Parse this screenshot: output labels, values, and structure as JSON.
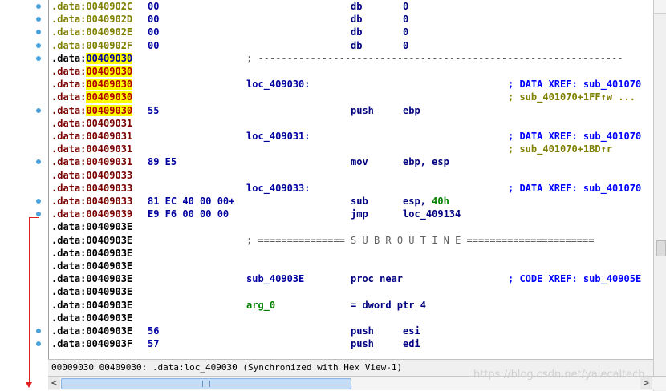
{
  "rows": [
    {
      "addr_prefix": ".data:",
      "addr": "0040902C",
      "bytes": "00",
      "mnem": "db",
      "ops": "0"
    },
    {
      "addr_prefix": ".data:",
      "addr": "0040902D",
      "bytes": "00",
      "mnem": "db",
      "ops": "0"
    },
    {
      "addr_prefix": ".data:",
      "addr": "0040902E",
      "bytes": "00",
      "mnem": "db",
      "ops": "0"
    },
    {
      "addr_prefix": ".data:",
      "addr": "0040902F",
      "bytes": "00",
      "mnem": "db",
      "ops": "0"
    },
    {
      "addr_prefix": ".data:",
      "addr": "00409030",
      "sep": "; ---------------------------------------------------------------"
    },
    {
      "addr_prefix": ".data:",
      "addr": "00409030"
    },
    {
      "addr_prefix": ".data:",
      "addr": "00409030",
      "label": "loc_409030:",
      "comment": "; DATA XREF: sub_401070"
    },
    {
      "addr_prefix": ".data:",
      "addr": "00409030",
      "comment": "; sub_401070+1FF↑w ..."
    },
    {
      "addr_prefix": ".data:",
      "addr": "00409030",
      "bytes": "55",
      "mnem": "push",
      "ops": "ebp"
    },
    {
      "addr_prefix": ".data:",
      "addr": "00409031"
    },
    {
      "addr_prefix": ".data:",
      "addr": "00409031",
      "label": "loc_409031:",
      "comment": "; DATA XREF: sub_401070"
    },
    {
      "addr_prefix": ".data:",
      "addr": "00409031",
      "comment": "; sub_401070+1BD↑r"
    },
    {
      "addr_prefix": ".data:",
      "addr": "00409031",
      "bytes": "89 E5",
      "mnem": "mov",
      "ops": "ebp, esp"
    },
    {
      "addr_prefix": ".data:",
      "addr": "00409033"
    },
    {
      "addr_prefix": ".data:",
      "addr": "00409033",
      "label": "loc_409033:",
      "comment": "; DATA XREF: sub_401070"
    },
    {
      "addr_prefix": ".data:",
      "addr": "00409033",
      "bytes": "81 EC 40 00 00+",
      "mnem": "sub",
      "ops": "esp, ",
      "imm": "40h"
    },
    {
      "addr_prefix": ".data:",
      "addr": "00409039",
      "bytes": "E9 F6 00 00 00",
      "mnem": "jmp",
      "ops": "loc_409134"
    },
    {
      "addr_prefix": ".data:",
      "addr": "0040903E"
    },
    {
      "addr_prefix": ".data:",
      "addr": "0040903E",
      "sep": "; =============== S U B R O U T I N E ======================"
    },
    {
      "addr_prefix": ".data:",
      "addr": "0040903E"
    },
    {
      "addr_prefix": ".data:",
      "addr": "0040903E"
    },
    {
      "addr_prefix": ".data:",
      "addr": "0040903E",
      "label": "sub_40903E",
      "mnem": "proc near",
      "comment": "; CODE XREF: sub_40905E"
    },
    {
      "addr_prefix": ".data:",
      "addr": "0040903E"
    },
    {
      "addr_prefix": ".data:",
      "addr": "0040903E",
      "arg": "arg_0",
      "mnem": "= dword ptr  4"
    },
    {
      "addr_prefix": ".data:",
      "addr": "0040903E"
    },
    {
      "addr_prefix": ".data:",
      "addr": "0040903E",
      "bytes": "56",
      "mnem": "push",
      "ops": "esi"
    },
    {
      "addr_prefix": ".data:",
      "addr": "0040903F",
      "bytes": "57",
      "mnem": "push",
      "ops": "edi"
    }
  ],
  "status": "00009030 00409030: .data:loc_409030 (Synchronized with Hex View-1)",
  "watermark": "https://blog.csdn.net/yalecaltech",
  "scroll": {
    "left_arrow": "<",
    "right_arrow": ">",
    "grip": "|||"
  },
  "colors": {
    "highlight": "#ffff00",
    "flow_arrow": "#e02020",
    "breakpoint_dot": "#4aa3df"
  }
}
